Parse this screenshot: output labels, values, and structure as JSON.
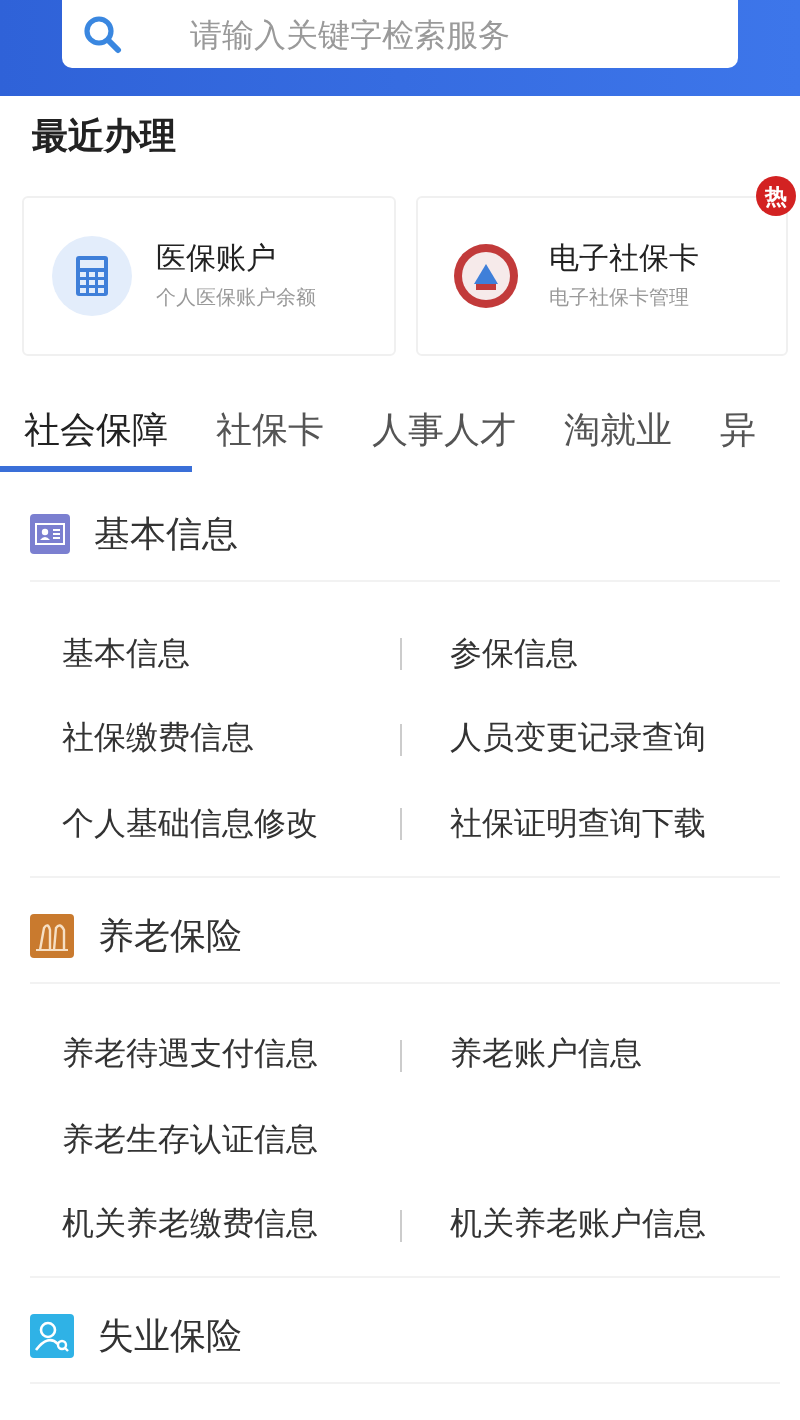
{
  "search": {
    "placeholder": "请输入关键字检索服务"
  },
  "recent": {
    "title": "最近办理",
    "cards": [
      {
        "kind": "calculator",
        "title": "医保账户",
        "subtitle": "个人医保账户余额",
        "hot": false
      },
      {
        "kind": "emblem",
        "title": "电子社保卡",
        "subtitle": "电子社保卡管理",
        "hot": true,
        "hot_label": "热"
      }
    ]
  },
  "tabs": [
    {
      "label": "社会保障",
      "selected": true
    },
    {
      "label": "社保卡",
      "selected": false
    },
    {
      "label": "人事人才",
      "selected": false
    },
    {
      "label": "淘就业",
      "selected": false
    },
    {
      "label": "异",
      "selected": false
    }
  ],
  "sections": [
    {
      "kind": "id-card",
      "title": "基本信息",
      "rows": [
        [
          "基本信息",
          "参保信息"
        ],
        [
          "社保缴费信息",
          "人员变更记录查询"
        ],
        [
          "个人基础信息修改",
          "社保证明查询下载"
        ]
      ]
    },
    {
      "kind": "elderly",
      "title": "养老保险",
      "rows": [
        [
          "养老待遇支付信息",
          "养老账户信息"
        ],
        [
          "养老生存认证信息"
        ],
        [
          "机关养老缴费信息",
          "机关养老账户信息"
        ]
      ]
    },
    {
      "kind": "person-search",
      "title": "失业保险"
    }
  ]
}
